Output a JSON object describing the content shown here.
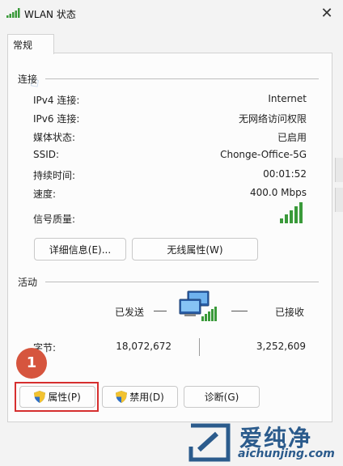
{
  "window": {
    "title": "WLAN 状态"
  },
  "tabs": [
    {
      "label": "常规"
    }
  ],
  "connection": {
    "section_label": "连接",
    "rows": [
      {
        "label": "IPv4 连接:",
        "value": "Internet"
      },
      {
        "label": "IPv6 连接:",
        "value": "无网络访问权限"
      },
      {
        "label": "媒体状态:",
        "value": "已启用"
      },
      {
        "label": "SSID:",
        "value": "Chonge-Office-5G"
      },
      {
        "label": "持续时间:",
        "value": "00:01:52"
      },
      {
        "label": "速度:",
        "value": "400.0 Mbps"
      }
    ],
    "signal_label": "信号质量:",
    "signal_bars": 5,
    "details_button": "详细信息(E)...",
    "wireless_props_button": "无线属性(W)"
  },
  "activity": {
    "section_label": "活动",
    "sent_label": "已发送",
    "received_label": "已接收",
    "bytes_label": "字节:",
    "bytes_sent": "18,072,672",
    "bytes_received": "3,252,609"
  },
  "buttons": {
    "properties": "属性(P)",
    "disable": "禁用(D)",
    "diagnose": "诊断(G)"
  },
  "annotation": {
    "step_number": "1"
  },
  "watermark": {
    "big": "爱纯净",
    "small": "aichunjing.com"
  },
  "colors": {
    "accent": "#2b5b8c",
    "highlight_red": "#d62f2f",
    "badge": "#d6553e",
    "signal_green": "#3a9a3a"
  }
}
